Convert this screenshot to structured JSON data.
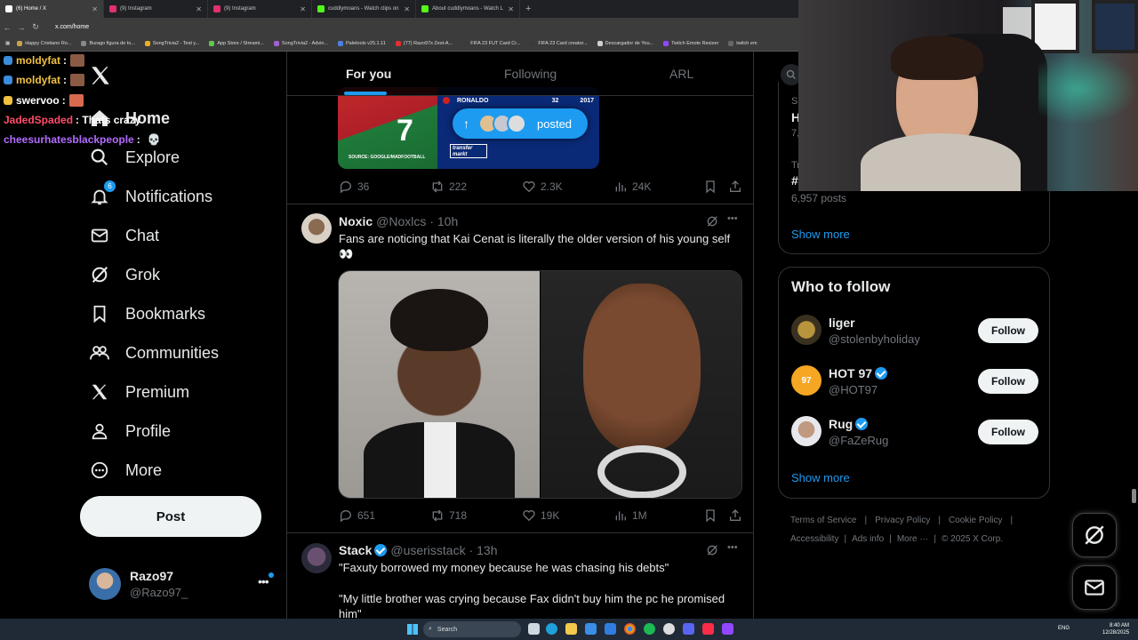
{
  "browser": {
    "tabs": [
      {
        "label": "(6) Home / X",
        "active": true,
        "color": "#e7e9ea"
      },
      {
        "label": "(9) Instagram",
        "active": false,
        "color": "#e1306c"
      },
      {
        "label": "(9) Instagram",
        "active": false,
        "color": "#e1306c"
      },
      {
        "label": "cuddlymoans - Watch clips on",
        "active": false,
        "color": "#53fc18"
      },
      {
        "label": "About cuddlymoans - Watch L",
        "active": false,
        "color": "#53fc18"
      }
    ],
    "url": "x.com/home",
    "bookmarks": [
      "Happy Cristiano Ro...",
      "Burago figura de to...",
      "SongTrivia2 - Test y...",
      "App Store / Streami...",
      "SongTrivia2 - Advin...",
      "Paletools v25.1.11",
      "(77) Razo97s Zest-A...",
      "FIFA 23 FUT Card Cr...",
      "FIFA 23 Card creator...",
      "Descargador de You...",
      "Twitch Emote Resizer",
      "twitch em"
    ]
  },
  "chat": [
    {
      "user": "moldyfat",
      "text": ":",
      "color": "#f0c040"
    },
    {
      "user": "moldyfat",
      "text": ":",
      "color": "#f0c040"
    },
    {
      "user": "swervoo",
      "text": ":",
      "color": "#ffffff"
    },
    {
      "user": "JadedSpaded",
      "text": ": Thats crazy",
      "color": "#ff4d6a"
    },
    {
      "user": "cheesurhatesblackpeople",
      "text": ":",
      "color": "#b36bff"
    }
  ],
  "sidebar": {
    "items": [
      {
        "label": "Home",
        "icon": "home-icon"
      },
      {
        "label": "Explore",
        "icon": "search-icon"
      },
      {
        "label": "Notifications",
        "icon": "bell-icon",
        "badge": "6"
      },
      {
        "label": "Chat",
        "icon": "mail-icon"
      },
      {
        "label": "Grok",
        "icon": "grok-icon"
      },
      {
        "label": "Bookmarks",
        "icon": "bookmark-icon"
      },
      {
        "label": "Communities",
        "icon": "communities-icon"
      },
      {
        "label": "Premium",
        "icon": "x-logo-icon"
      },
      {
        "label": "Profile",
        "icon": "person-icon"
      },
      {
        "label": "More",
        "icon": "more-circle-icon"
      }
    ],
    "post_label": "Post",
    "account": {
      "name": "Razo97",
      "handle": "@Razo97_"
    }
  },
  "feed": {
    "tabs": [
      "For you",
      "Following",
      "ARL"
    ],
    "posted_pill": "posted",
    "top_card": {
      "player": "RONALDO",
      "age": "32",
      "year": "2017",
      "source": "SOURCE: GOOGLE/MADFOOTBALL",
      "brand": "transfer markt"
    },
    "tweets": [
      {
        "replies": "36",
        "reposts": "222",
        "likes": "2.3K",
        "views": "24K"
      },
      {
        "name": "Noxic",
        "handle": "@Noxlcs",
        "time": "· 10h",
        "text": "Fans are noticing that Kai Cenat is literally the older version of his young self 👀",
        "replies": "651",
        "reposts": "718",
        "likes": "19K",
        "views": "1M"
      },
      {
        "name": "Stack",
        "handle": "@userisstack",
        "time": "· 13h",
        "text1": "\"Faxuty borrowed my money because he was chasing his debts\"",
        "text2": "\"My little brother was crying because Fax didn't buy him the pc he promised him\""
      }
    ]
  },
  "right": {
    "trend_header": "S",
    "trend_count_1": "7,",
    "trend_label_2": "Tr",
    "trend_count": "6,957 posts",
    "show_more": "Show more",
    "who_to_follow": "Who to follow",
    "follow_label": "Follow",
    "suggestions": [
      {
        "name": "liger",
        "handle": "@stolenbyholiday",
        "verified": false
      },
      {
        "name": "HOT 97",
        "handle": "@HOT97",
        "verified": true
      },
      {
        "name": "Rug",
        "handle": "@FaZeRug",
        "verified": true
      }
    ],
    "footer_row1": [
      "Terms of Service",
      "Privacy Policy",
      "Cookie Policy"
    ],
    "footer_row2": [
      "Accessibility",
      "Ads info",
      "More ···",
      "© 2025 X Corp."
    ]
  },
  "taskbar": {
    "search": "Search",
    "lang": "ENG",
    "time": "8:40 AM",
    "date": "12/28/2025"
  }
}
